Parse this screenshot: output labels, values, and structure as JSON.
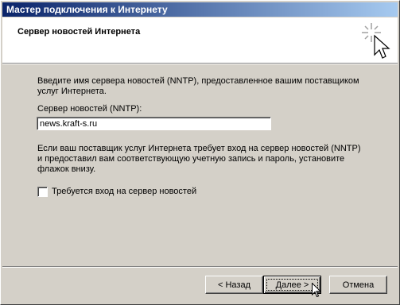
{
  "window": {
    "title": "Мастер подключения к Интернету"
  },
  "header": {
    "title": "Сервер новостей Интернета",
    "icon": "wizard-sparkle-cursor-icon"
  },
  "content": {
    "intro_line1": "Введите имя сервера новостей (NNTP), предоставленное вашим поставщиком",
    "intro_line2": "услуг Интернета.",
    "server_label": "Сервер новостей (NNTP):",
    "server_value": "news.kraft-s.ru",
    "info_line1": "Если ваш поставщик услуг Интернета требует вход на сервер новостей (NNTP)",
    "info_line2": "и предоставил вам соответствующую учетную запись и пароль, установите",
    "info_line3": "флажок внизу.",
    "checkbox_label": "Требуется вход на сервер новостей",
    "checkbox_checked": false
  },
  "buttons": {
    "back": "< Назад",
    "next": "Далее >",
    "cancel": "Отмена"
  },
  "colors": {
    "titlebar_start": "#0a246a",
    "titlebar_end": "#a6caf0",
    "face": "#d4d0c8"
  }
}
